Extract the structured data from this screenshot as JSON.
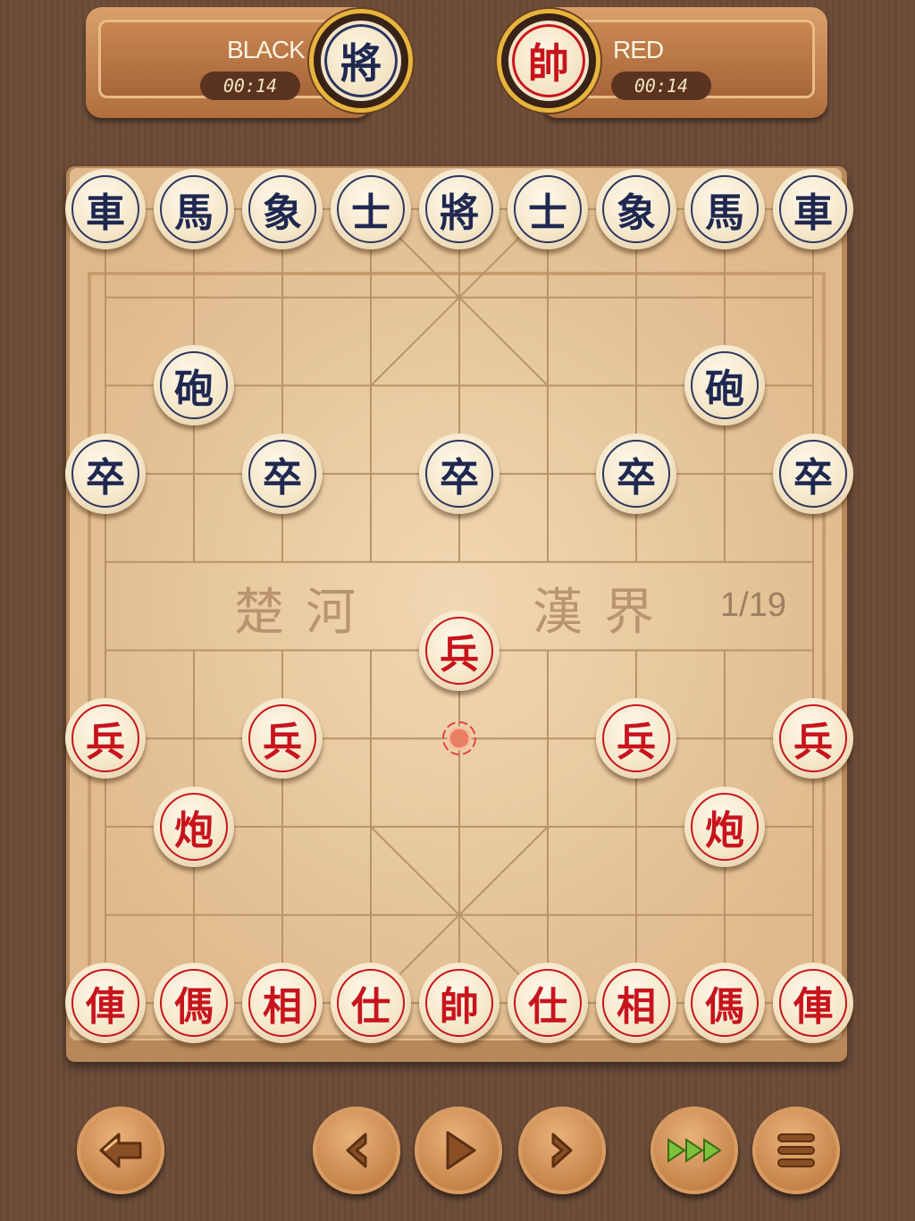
{
  "players": {
    "black": {
      "name": "BLACK",
      "timer": "00:14",
      "avatar_piece": "將"
    },
    "red": {
      "name": "RED",
      "timer": "00:14",
      "avatar_piece": "帥"
    }
  },
  "board": {
    "river_left": "楚河",
    "river_right": "漢界",
    "move_counter": "1/19",
    "last_move_target": {
      "col": 4,
      "row": 6
    },
    "pieces": [
      {
        "side": "black",
        "char": "車",
        "col": 0,
        "row": 0
      },
      {
        "side": "black",
        "char": "馬",
        "col": 1,
        "row": 0
      },
      {
        "side": "black",
        "char": "象",
        "col": 2,
        "row": 0
      },
      {
        "side": "black",
        "char": "士",
        "col": 3,
        "row": 0
      },
      {
        "side": "black",
        "char": "將",
        "col": 4,
        "row": 0
      },
      {
        "side": "black",
        "char": "士",
        "col": 5,
        "row": 0
      },
      {
        "side": "black",
        "char": "象",
        "col": 6,
        "row": 0
      },
      {
        "side": "black",
        "char": "馬",
        "col": 7,
        "row": 0
      },
      {
        "side": "black",
        "char": "車",
        "col": 8,
        "row": 0
      },
      {
        "side": "black",
        "char": "砲",
        "col": 1,
        "row": 2
      },
      {
        "side": "black",
        "char": "砲",
        "col": 7,
        "row": 2
      },
      {
        "side": "black",
        "char": "卒",
        "col": 0,
        "row": 3
      },
      {
        "side": "black",
        "char": "卒",
        "col": 2,
        "row": 3
      },
      {
        "side": "black",
        "char": "卒",
        "col": 4,
        "row": 3
      },
      {
        "side": "black",
        "char": "卒",
        "col": 6,
        "row": 3
      },
      {
        "side": "black",
        "char": "卒",
        "col": 8,
        "row": 3
      },
      {
        "side": "red",
        "char": "兵",
        "col": 4,
        "row": 5
      },
      {
        "side": "red",
        "char": "兵",
        "col": 0,
        "row": 6
      },
      {
        "side": "red",
        "char": "兵",
        "col": 2,
        "row": 6
      },
      {
        "side": "red",
        "char": "兵",
        "col": 6,
        "row": 6
      },
      {
        "side": "red",
        "char": "兵",
        "col": 8,
        "row": 6
      },
      {
        "side": "red",
        "char": "炮",
        "col": 1,
        "row": 7
      },
      {
        "side": "red",
        "char": "炮",
        "col": 7,
        "row": 7
      },
      {
        "side": "red",
        "char": "俥",
        "col": 0,
        "row": 9
      },
      {
        "side": "red",
        "char": "傌",
        "col": 1,
        "row": 9
      },
      {
        "side": "red",
        "char": "相",
        "col": 2,
        "row": 9
      },
      {
        "side": "red",
        "char": "仕",
        "col": 3,
        "row": 9
      },
      {
        "side": "red",
        "char": "帥",
        "col": 4,
        "row": 9
      },
      {
        "side": "red",
        "char": "仕",
        "col": 5,
        "row": 9
      },
      {
        "side": "red",
        "char": "相",
        "col": 6,
        "row": 9
      },
      {
        "side": "red",
        "char": "傌",
        "col": 7,
        "row": 9
      },
      {
        "side": "red",
        "char": "俥",
        "col": 8,
        "row": 9
      }
    ]
  },
  "controls": [
    {
      "name": "back-button",
      "icon": "back-arrow-icon"
    },
    {
      "name": "previous-move-button",
      "icon": "chevron-left-icon"
    },
    {
      "name": "play-button",
      "icon": "play-icon"
    },
    {
      "name": "next-move-button",
      "icon": "chevron-right-icon"
    },
    {
      "name": "fast-forward-button",
      "icon": "fast-forward-icon"
    },
    {
      "name": "menu-button",
      "icon": "menu-icon"
    }
  ],
  "colors": {
    "black_piece": "#1f2850",
    "red_piece": "#c8141c",
    "ff_arrows": "#7cc23a"
  }
}
